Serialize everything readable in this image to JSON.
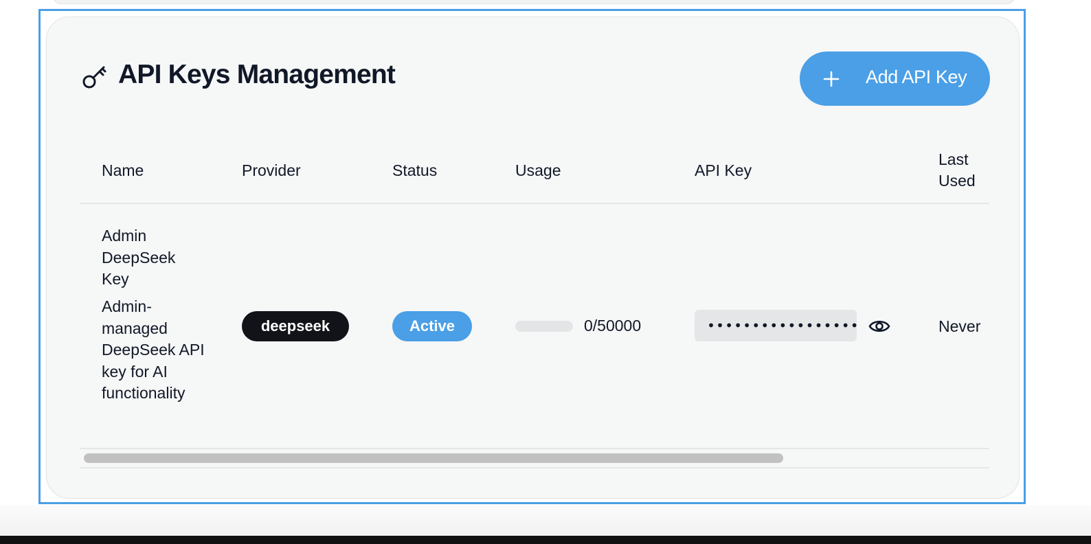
{
  "panel": {
    "title": "API Keys Management",
    "add_button_label": "Add API Key",
    "icons": {
      "title": "key-icon",
      "add": "plus-icon",
      "reveal": "eye-icon"
    },
    "colors": {
      "accent": "#4a9fe6",
      "provider_badge": "#111318",
      "card_bg": "#f6f7f7"
    }
  },
  "table": {
    "columns": [
      "Name",
      "Provider",
      "Status",
      "Usage",
      "API Key",
      "Last Used"
    ],
    "rows": [
      {
        "name": "Admin DeepSeek Key",
        "description": "Admin-managed DeepSeek API key for AI functionality",
        "provider": "deepseek",
        "status": "Active",
        "usage_text": "0/50000",
        "usage_fraction": 0,
        "api_key_masked": "••••••••••••••••••••",
        "last_used": "Never"
      }
    ]
  }
}
